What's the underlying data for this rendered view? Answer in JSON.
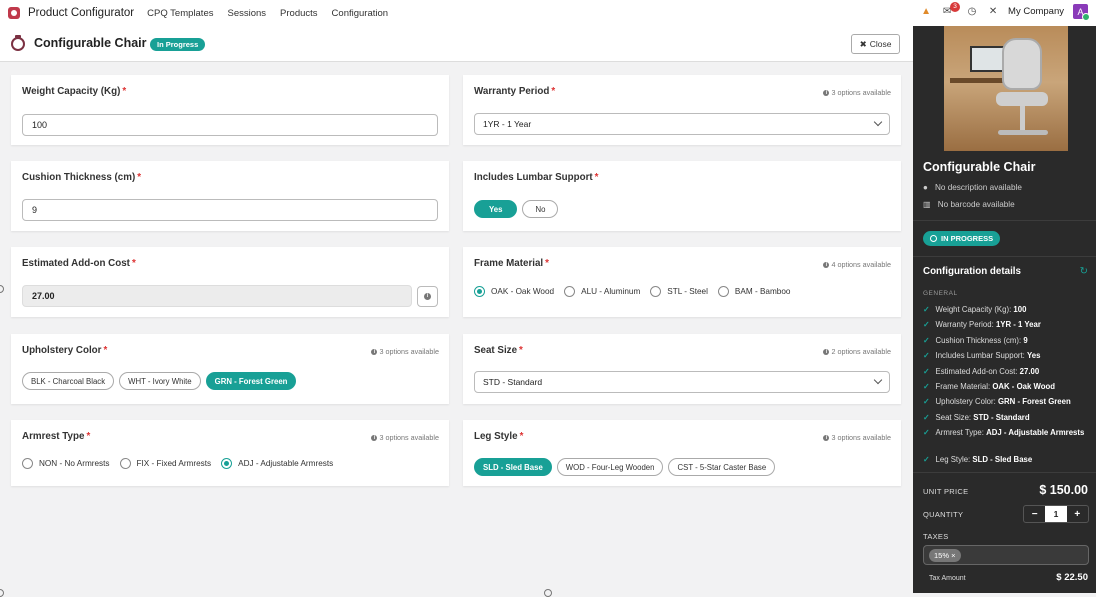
{
  "topbar": {
    "app_title": "Product Configurator",
    "nav": [
      "CPQ Templates",
      "Sessions",
      "Products",
      "Configuration"
    ],
    "chat_badge": "3",
    "company": "My Company",
    "avatar_letter": "A"
  },
  "control": {
    "title": "Configurable Chair",
    "status": "In Progress",
    "close_label": "Close"
  },
  "fields": {
    "weight": {
      "label": "Weight Capacity (Kg)",
      "value": "100"
    },
    "warranty": {
      "label": "Warranty Period",
      "avail": "3 options available",
      "value": "1YR - 1 Year"
    },
    "cushion": {
      "label": "Cushion Thickness (cm)",
      "value": "9"
    },
    "lumbar": {
      "label": "Includes Lumbar Support",
      "yes": "Yes",
      "no": "No"
    },
    "addon": {
      "label": "Estimated Add-on Cost",
      "value": "27.00"
    },
    "frame": {
      "label": "Frame Material",
      "avail": "4 options available",
      "options": [
        "OAK - Oak Wood",
        "ALU - Aluminum",
        "STL - Steel",
        "BAM - Bamboo"
      ]
    },
    "upholstery": {
      "label": "Upholstery Color",
      "avail": "3 options available",
      "options": [
        "BLK - Charcoal Black",
        "WHT - Ivory White",
        "GRN - Forest Green"
      ]
    },
    "seat": {
      "label": "Seat Size",
      "avail": "2 options available",
      "value": "STD - Standard"
    },
    "armrest": {
      "label": "Armrest Type",
      "avail": "3 options available",
      "options": [
        "NON - No Armrests",
        "FIX - Fixed Armrests",
        "ADJ - Adjustable Armrests"
      ]
    },
    "leg": {
      "label": "Leg Style",
      "avail": "3 options available",
      "options": [
        "SLD - Sled Base",
        "WOD - Four-Leg Wooden",
        "CST - 5-Star Caster Base"
      ]
    }
  },
  "panel": {
    "product_name": "Configurable Chair",
    "no_description": "No description available",
    "no_barcode": "No barcode available",
    "status": "IN PROGRESS",
    "section_title": "Configuration details",
    "group": "GENERAL",
    "details": [
      {
        "k": "Weight Capacity (Kg):",
        "v": "100"
      },
      {
        "k": "Warranty Period:",
        "v": "1YR - 1 Year"
      },
      {
        "k": "Cushion Thickness (cm):",
        "v": "9"
      },
      {
        "k": "Includes Lumbar Support:",
        "v": "Yes"
      },
      {
        "k": "Estimated Add-on Cost:",
        "v": "27.00"
      },
      {
        "k": "Frame Material:",
        "v": "OAK - Oak Wood"
      },
      {
        "k": "Upholstery Color:",
        "v": "GRN - Forest Green"
      },
      {
        "k": "Seat Size:",
        "v": "STD - Standard"
      },
      {
        "k": "Armrest Type:",
        "v": "ADJ - Adjustable Armrests"
      },
      {
        "k": "Leg Style:",
        "v": "SLD - Sled Base"
      }
    ],
    "unit_price_label": "UNIT PRICE",
    "unit_price": "$ 150.00",
    "quantity_label": "QUANTITY",
    "quantity": "1",
    "taxes_label": "TAXES",
    "tax_tag": "15%",
    "tax_amount_label": "Tax Amount",
    "tax_amount": "$ 22.50"
  },
  "colors": {
    "accent": "#18a096",
    "required": "#dd3333",
    "panel_bg": "#2a2a2a"
  }
}
